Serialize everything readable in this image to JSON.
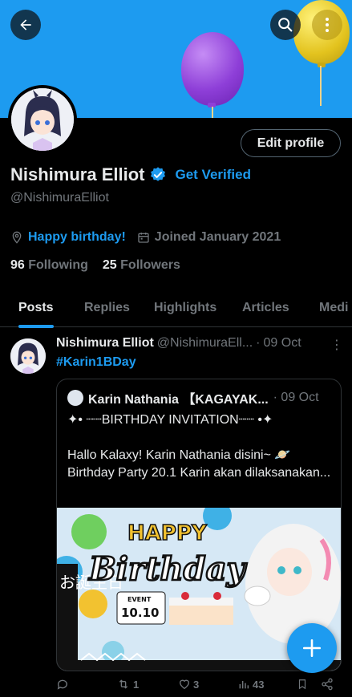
{
  "profile": {
    "display_name": "Nishimura Elliot",
    "get_verified": "Get Verified",
    "handle": "@NishimuraElliot",
    "edit_profile": "Edit profile",
    "location": "Happy birthday!",
    "joined": "Joined January 2021",
    "following_count": "96",
    "following_label": "Following",
    "followers_count": "25",
    "followers_label": "Followers"
  },
  "tabs": [
    {
      "label": "Posts",
      "active": true
    },
    {
      "label": "Replies",
      "active": false
    },
    {
      "label": "Highlights",
      "active": false
    },
    {
      "label": "Articles",
      "active": false
    },
    {
      "label": "Medi",
      "active": false
    }
  ],
  "post": {
    "name": "Nishimura Elliot",
    "handle": "@NishimuraEll...",
    "separator": "·",
    "date": "09 Oct",
    "more": "⋮",
    "hashtag": "#Karin1BDay",
    "quote": {
      "name": "Karin Nathania 【KAGAYAK...",
      "date": "· 09 Oct",
      "line1": "✦• ┈┈BIRTHDAY INVITATION┈┈ •✦",
      "line2": "Hallo Kalaxy! Karin Nathania disini~ 🪐 Birthday Party 20.1 Karin akan dilaksanakan...",
      "image_text": {
        "happy": "HAPPY",
        "birthday": "Birthday",
        "event": "EVENT",
        "date": "10.10",
        "jp": "お誕生日"
      }
    },
    "actions": {
      "reply": "",
      "repost": "1",
      "like": "3",
      "views": "43"
    }
  },
  "icons": {
    "back": "arrow-left-icon",
    "search": "search-icon",
    "more": "more-vertical-icon",
    "verified": "verified-badge-icon",
    "location": "location-pin-icon",
    "calendar": "calendar-icon",
    "compose": "plus-icon"
  },
  "colors": {
    "accent": "#1d9bf0",
    "banner": "#1d9bf0",
    "background": "#000000",
    "muted": "#71767b"
  }
}
